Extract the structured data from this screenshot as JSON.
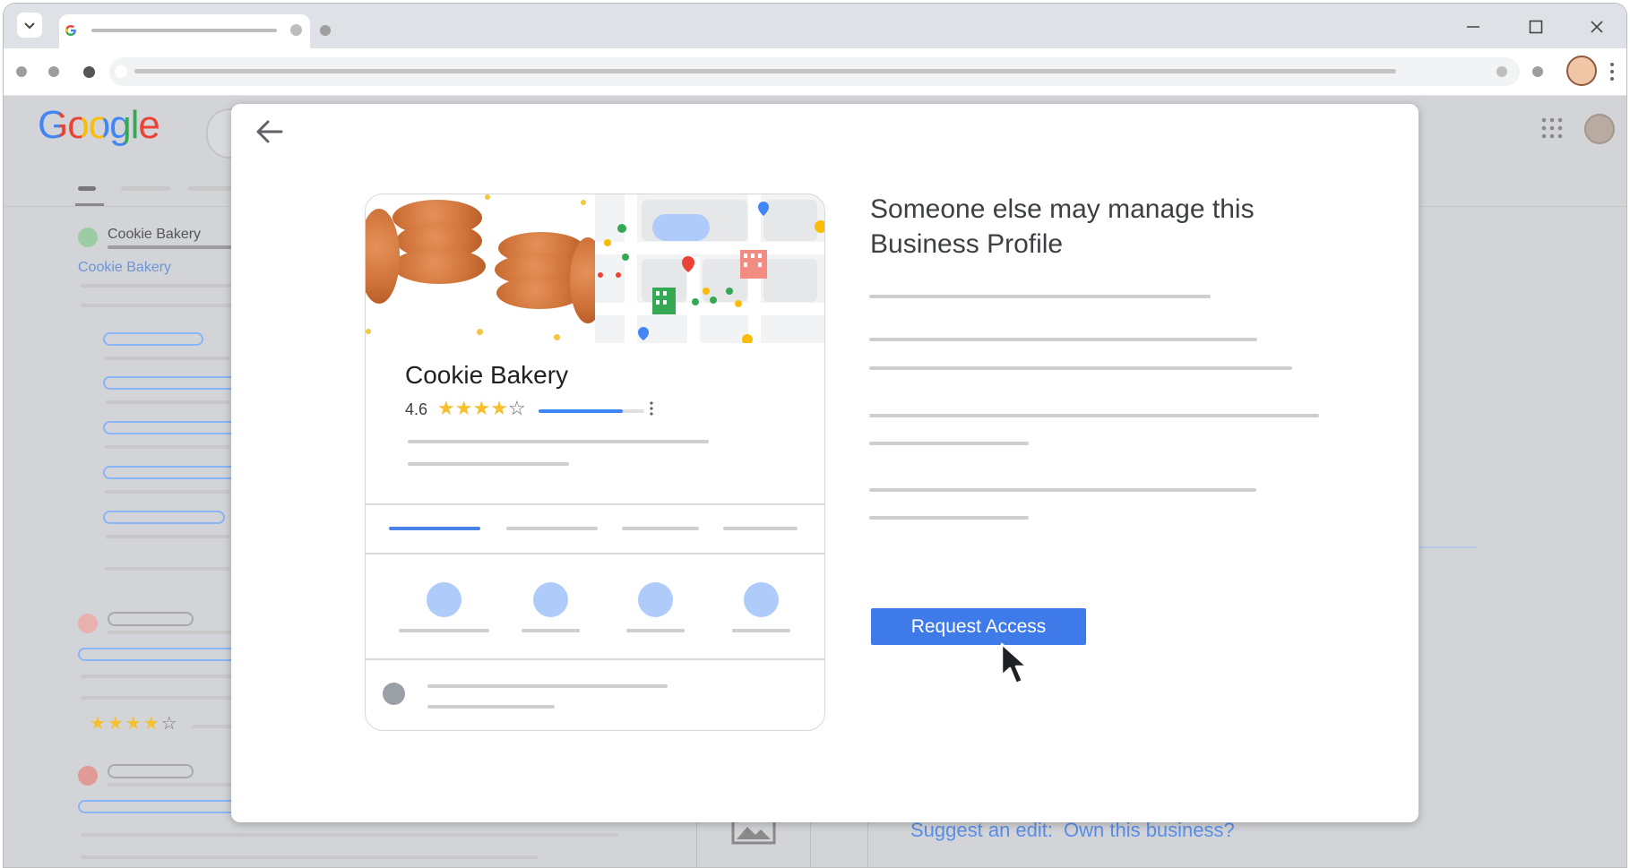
{
  "browser": {
    "tab_icon": "google-g-icon",
    "window_controls": [
      "minimize-icon",
      "maximize-icon",
      "close-icon"
    ]
  },
  "google": {
    "logo_text": "Google",
    "logo_colors": [
      "#4285f4",
      "#ea4335",
      "#fbbc05",
      "#4285f4",
      "#34a853",
      "#ea4335"
    ]
  },
  "background_results": {
    "first_result_title": "Cookie Bakery",
    "first_result_link": "Cookie Bakery",
    "rating_stars_filled": 4,
    "rating_stars_total": 5
  },
  "knowledge_panel": {
    "suggest_edit": "Suggest an edit:",
    "own_business": "Own this business?"
  },
  "modal": {
    "back_icon": "arrow-left-icon",
    "heading_line1": "Someone else may manage this",
    "heading_line2": "Business Profile",
    "request_access": "Request Access"
  },
  "business_card": {
    "name": "Cookie Bakery",
    "rating": "4.6",
    "stars_filled": 4,
    "stars_total": 5,
    "rating_bar_fraction": 0.8
  },
  "colors": {
    "accent_blue": "#3f7be8",
    "link_blue": "#4f86e6",
    "star_yellow": "#f6c02e",
    "page_gray": "#d2d4d7"
  }
}
